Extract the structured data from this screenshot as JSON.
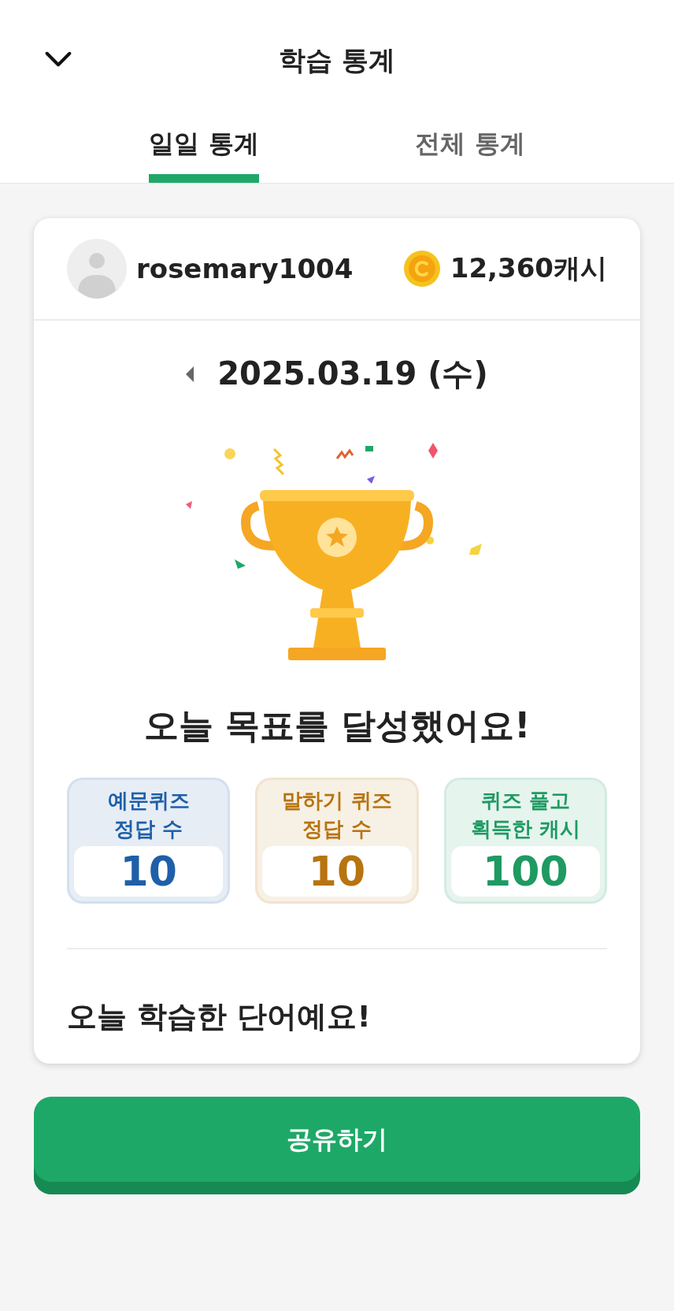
{
  "header": {
    "title": "학습 통계"
  },
  "tabs": [
    {
      "label": "일일 통계",
      "selected": true
    },
    {
      "label": "전체 통계",
      "selected": false
    }
  ],
  "profile": {
    "username": "rosemary1004",
    "cash": "12,360캐시"
  },
  "date": "2025.03.19 (수)",
  "headline": "오늘 목표를 달성했어요!",
  "stats": [
    {
      "label_lines": [
        "예문퀴즈",
        "정답 수"
      ],
      "value": "10",
      "color": "#1f5fa8"
    },
    {
      "label_lines": [
        "말하기 퀴즈",
        "정답 수"
      ],
      "value": "10",
      "color": "#b7740f"
    },
    {
      "label_lines": [
        "퀴즈 풀고",
        "획득한 캐시"
      ],
      "value": "100",
      "color": "#1e9a62"
    }
  ],
  "words_title": "오늘 학습한 단어예요!",
  "share_button": "공유하기"
}
